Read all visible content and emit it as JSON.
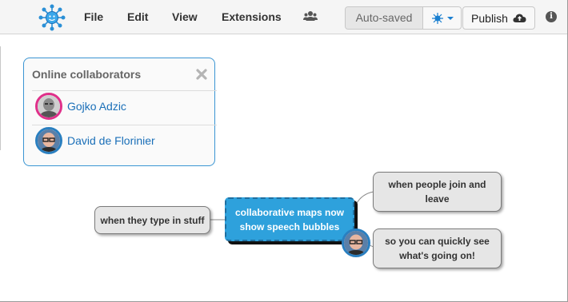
{
  "toolbar": {
    "menu": [
      "File",
      "Edit",
      "View",
      "Extensions"
    ],
    "autosaved": "Auto-saved",
    "publish": "Publish",
    "info": "i"
  },
  "collaborators": {
    "title": "Online collaborators",
    "people": [
      {
        "name": "Gojko Adzic",
        "ring_color": "#e0308a"
      },
      {
        "name": "David de Florinier",
        "ring_color": "#2a7fc0"
      }
    ]
  },
  "map": {
    "center": "collaborative maps now show speech bubbles",
    "left": "when they type in stuff",
    "right_top": "when people join and leave",
    "right_bottom": "so you can quickly see what's going on!"
  },
  "colors": {
    "accent": "#2ea1dc",
    "link": "#1a6fb8"
  }
}
